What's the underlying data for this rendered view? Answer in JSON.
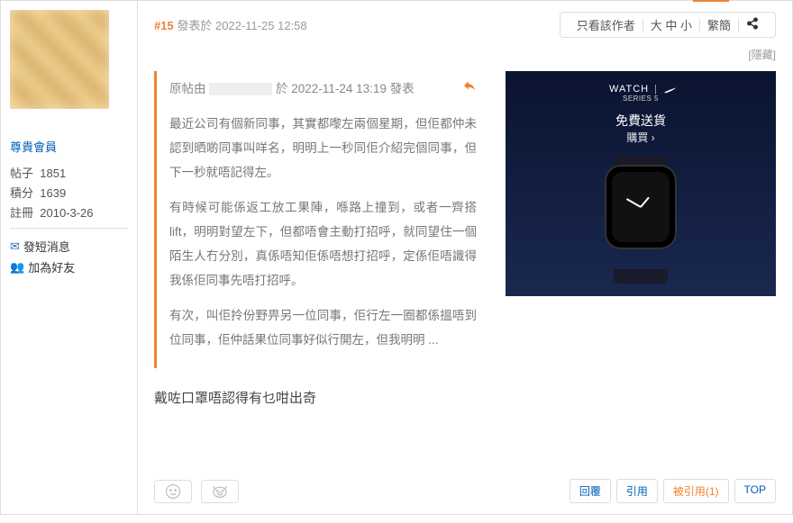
{
  "sidebar": {
    "member_rank": "尊貴會員",
    "stats": {
      "posts_label": "帖子",
      "posts_value": "1851",
      "points_label": "積分",
      "points_value": "1639",
      "reg_label": "註冊",
      "reg_value": "2010-3-26"
    },
    "actions": {
      "pm": "發短消息",
      "friend": "加為好友"
    }
  },
  "post": {
    "number": "#15",
    "posted_prefix": "發表於",
    "posted_at": "2022-11-25 12:58",
    "header_actions": {
      "only_author": "只看該作者",
      "size": "大 中 小",
      "simp": "繁簡"
    },
    "hidden_label": "[隱藏]",
    "quote": {
      "prefix": "原帖由",
      "meta": "於  2022-11-24  13:19  發表",
      "p1": "最近公司有個新同事，其實都嚟左兩個星期，但佢都仲未認到晒啲同事叫咩名，明明上一秒同佢介紹完個同事，但下一秒就唔記得左。",
      "p2": "有時候可能係返工放工果陣，喺路上撞到，或者一齊搭lift，明明對望左下，但都唔會主動打招呼，就同望住一個陌生人冇分別，真係唔知佢係唔想打招呼，定係佢唔識得我係佢同事先唔打招呼。",
      "p3": "有次，叫佢拎份野畀另一位同事，佢行左一圈都係搵唔到位同事，佢仲話果位同事好似行開左，但我明明  ..."
    },
    "reply": "戴咗口罩唔認得有乜咁出奇"
  },
  "ad": {
    "brand": "WATCH",
    "series": "SERIES 5",
    "cta1": "免費送貨",
    "cta2": "購買 ›"
  },
  "footer": {
    "reply": "回覆",
    "quote": "引用",
    "cited": "被引用(1)",
    "top": "TOP"
  }
}
